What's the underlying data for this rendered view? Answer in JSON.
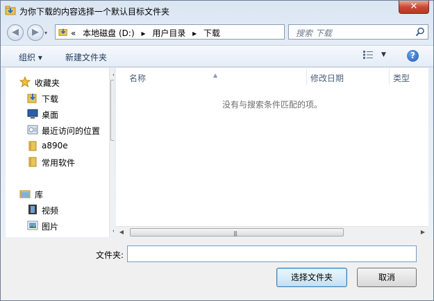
{
  "window": {
    "title": "为你下载的内容选择一个默认目标文件夹",
    "close_label": "✕"
  },
  "address": {
    "prefix": "«",
    "segments": [
      "本地磁盘 (D:)",
      "用户目录",
      "下载"
    ],
    "separator": "▸"
  },
  "search": {
    "placeholder": "搜索 下载"
  },
  "toolbar": {
    "organize": "组织 ▾",
    "new_folder": "新建文件夹",
    "help": "?"
  },
  "nav": {
    "favorites": "收藏夹",
    "favorite_items": [
      "下载",
      "桌面",
      "最近访问的位置",
      "a890e",
      "常用软件"
    ],
    "libraries": "库",
    "library_items": [
      "视频",
      "图片"
    ]
  },
  "columns": [
    "名称",
    "修改日期",
    "类型"
  ],
  "empty_message": "没有与搜索条件匹配的项。",
  "folder_field": {
    "label": "文件夹:",
    "value": ""
  },
  "buttons": {
    "select": "选择文件夹",
    "cancel": "取消"
  },
  "icons": {
    "favorites": "star-icon",
    "download": "download-folder-icon",
    "desktop": "desktop-icon",
    "recent": "recent-places-icon",
    "folder": "folder-icon",
    "library": "library-icon",
    "video": "video-icon",
    "picture": "picture-icon"
  }
}
